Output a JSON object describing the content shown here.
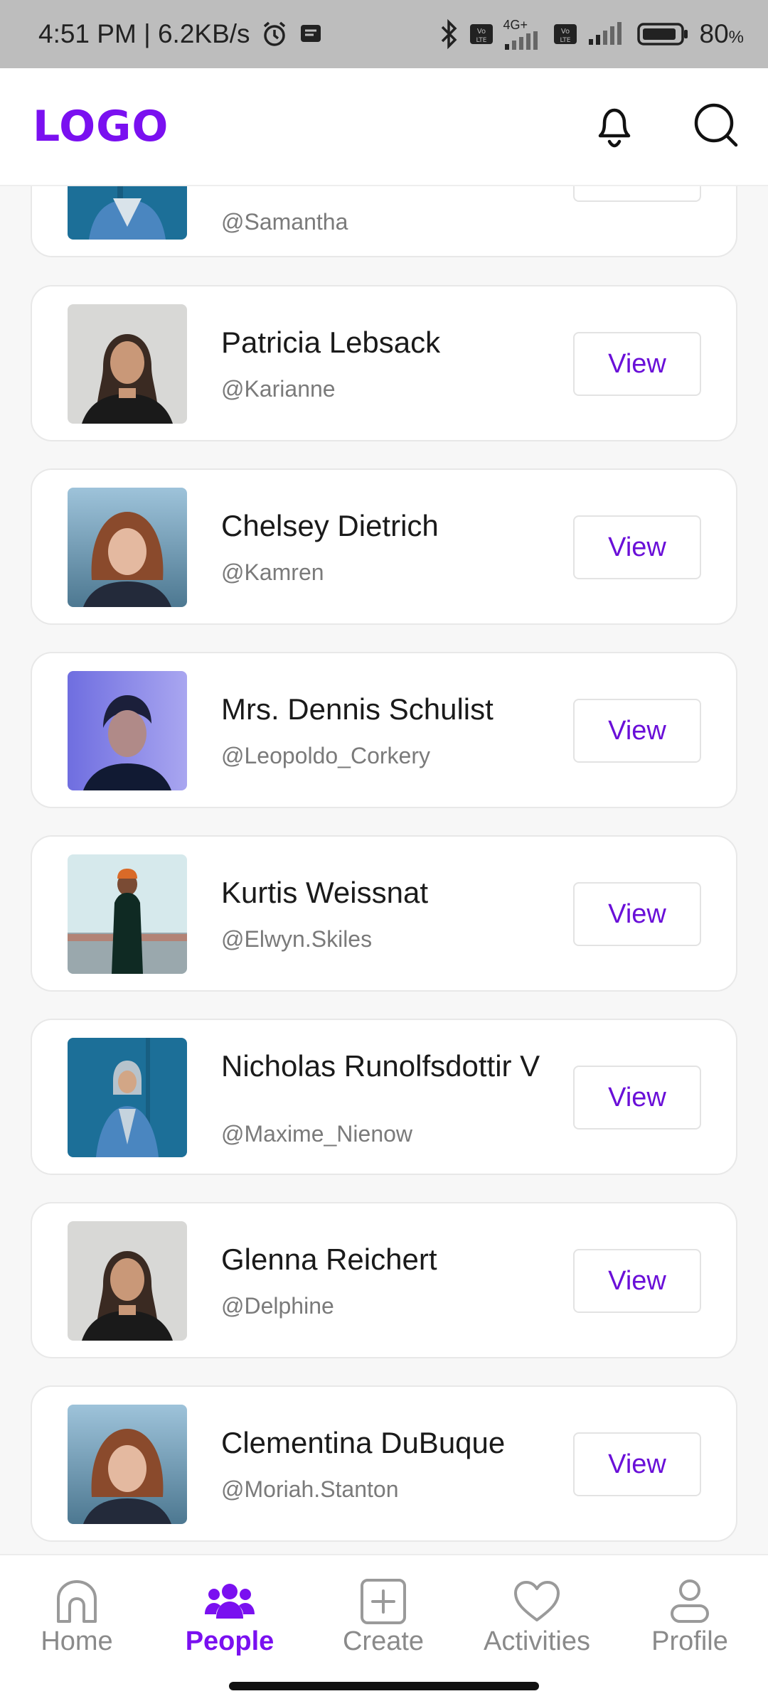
{
  "status_bar": {
    "time_speed": "4:51 PM | 6.2KB/s",
    "network": "4G+",
    "battery": "80",
    "battery_suffix": "%",
    "icons": [
      "alarm-icon",
      "message-icon",
      "bluetooth-icon",
      "volte-icon",
      "signal-icon",
      "battery-icon"
    ]
  },
  "header": {
    "logo": "LOGO",
    "icons": [
      "bell-icon",
      "search-icon"
    ]
  },
  "people": [
    {
      "name": "",
      "handle": "@Samantha",
      "button": ""
    },
    {
      "name": "Patricia Lebsack",
      "handle": "@Karianne",
      "button": "View"
    },
    {
      "name": "Chelsey Dietrich",
      "handle": "@Kamren",
      "button": "View"
    },
    {
      "name": "Mrs. Dennis Schulist",
      "handle": "@Leopoldo_Corkery",
      "button": "View"
    },
    {
      "name": "Kurtis Weissnat",
      "handle": "@Elwyn.Skiles",
      "button": "View"
    },
    {
      "name": "Nicholas Runolfsdottir V",
      "handle": "@Maxime_Nienow",
      "button": "View"
    },
    {
      "name": "Glenna Reichert",
      "handle": "@Delphine",
      "button": "View"
    },
    {
      "name": "Clementina DuBuque",
      "handle": "@Moriah.Stanton",
      "button": "View"
    }
  ],
  "nav": {
    "items": [
      {
        "label": "Home",
        "icon": "home-icon",
        "active": false
      },
      {
        "label": "People",
        "icon": "people-icon",
        "active": true
      },
      {
        "label": "Create",
        "icon": "plus-square-icon",
        "active": false
      },
      {
        "label": "Activities",
        "icon": "heart-icon",
        "active": false
      },
      {
        "label": "Profile",
        "icon": "user-icon",
        "active": false
      }
    ]
  },
  "colors": {
    "accent": "#7a10f0",
    "button_text": "#6a0fd8",
    "status_bar_bg": "#bdbdbd"
  }
}
